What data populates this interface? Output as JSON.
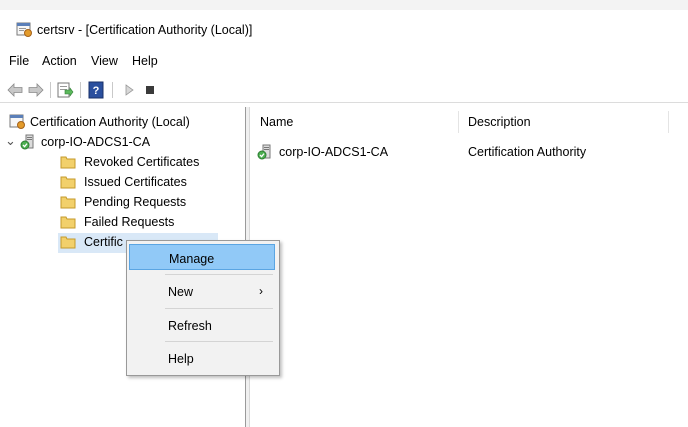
{
  "window": {
    "title": "certsrv - [Certification Authority (Local)]"
  },
  "menu": [
    "File",
    "Action",
    "View",
    "Help"
  ],
  "toolbar": {
    "buttons": [
      "back-arrow-icon",
      "forward-arrow-icon",
      "export-list-icon",
      "help-book-icon",
      "play-icon",
      "stop-icon"
    ]
  },
  "tree": {
    "root": "Certification Authority (Local)",
    "ca": "corp-IO-ADCS1-CA",
    "folders": [
      "Revoked Certificates",
      "Issued Certificates",
      "Pending Requests",
      "Failed Requests",
      "Certific"
    ]
  },
  "list": {
    "columns": [
      "Name",
      "Description"
    ],
    "rows": [
      {
        "name": "corp-IO-ADCS1-CA",
        "description": "Certification Authority"
      }
    ]
  },
  "context_menu": {
    "items": [
      "Manage",
      "New",
      "Refresh",
      "Help"
    ],
    "highlighted": "Manage"
  },
  "colors": {
    "selection": "#91c9f7",
    "folder": "#f2d06b"
  }
}
